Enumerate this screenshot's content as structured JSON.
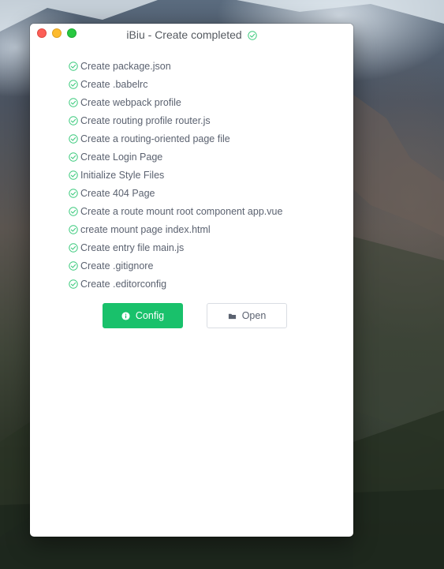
{
  "window": {
    "title": "iBiu - Create completed",
    "title_icon": "check-circle-icon"
  },
  "steps": [
    {
      "label": "Create package.json",
      "icon": "check-circle-icon"
    },
    {
      "label": "Create .babelrc",
      "icon": "check-circle-icon"
    },
    {
      "label": "Create webpack profile",
      "icon": "check-circle-icon"
    },
    {
      "label": "Create routing profile router.js",
      "icon": "check-circle-icon"
    },
    {
      "label": "Create a routing-oriented page file",
      "icon": "check-circle-icon"
    },
    {
      "label": "Create Login Page",
      "icon": "check-circle-icon"
    },
    {
      "label": "Initialize Style Files",
      "icon": "check-circle-icon"
    },
    {
      "label": "Create 404 Page",
      "icon": "check-circle-icon"
    },
    {
      "label": "Create a route mount root component app.vue",
      "icon": "check-circle-icon"
    },
    {
      "label": "create mount page index.html",
      "icon": "check-circle-icon"
    },
    {
      "label": "Create entry file main.js",
      "icon": "check-circle-icon"
    },
    {
      "label": "Create .gitignore",
      "icon": "check-circle-icon"
    },
    {
      "label": "Create .editorconfig",
      "icon": "check-circle-icon"
    }
  ],
  "actions": {
    "config_label": "Config",
    "config_icon": "info-circle-icon",
    "open_label": "Open",
    "open_icon": "folder-icon"
  },
  "colors": {
    "accent": "#19c16b",
    "check": "#3fcb7f",
    "text": "#5b6270"
  }
}
